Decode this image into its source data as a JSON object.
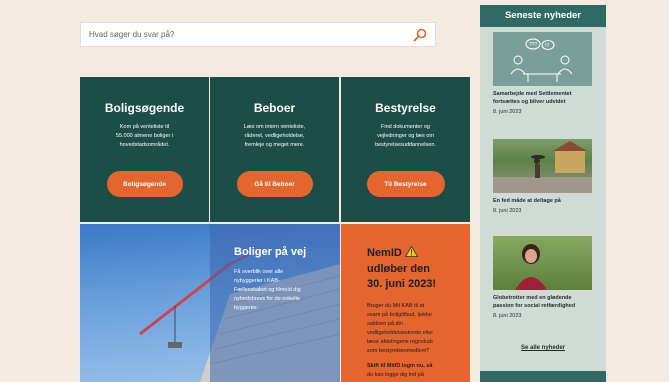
{
  "search": {
    "placeholder": "Hvad søger du svar på?"
  },
  "cards": [
    {
      "title": "Boligsøgende",
      "lines": [
        "Kom på venteliste til",
        "55.000 almene boliger i",
        "hovedstadsområdet."
      ],
      "button": "Boligsøgende"
    },
    {
      "title": "Beboer",
      "lines": [
        "Læs om intern venteliste,",
        "råderet, vedligeholdelse,",
        "fremleje og meget mere."
      ],
      "button": "Gå til Beboer"
    },
    {
      "title": "Bestyrelse",
      "lines": [
        "Find dokumenter og",
        "vejledninger og læs om",
        "bestyrelsesuddannelsen."
      ],
      "button": "Til Bestyrelse"
    }
  ],
  "promo": {
    "title": "Boliger på vej",
    "lines": [
      "Få overblik over alle",
      "nybyggerier i KAB-",
      "Fællesskabet og tilmeld dig",
      "nyhedsbrevs for de enkelte",
      "byggerier."
    ]
  },
  "alert": {
    "title_lines": [
      "NemID",
      "udløber den",
      "30. juni 2023!"
    ],
    "para_lines": [
      "Bruger du Mit KAB til at",
      "svare på boligtilbud, tjekke",
      "saldoen på din",
      "vedligeholdelseskonto eller",
      "læse afdelingens regnskab",
      "som bestyrelsesmedlem?"
    ],
    "para2_lines": [
      "Skift til MitID login nu, så",
      "du kan logge dig ind på"
    ]
  },
  "news": {
    "heading": "Seneste nyheder",
    "items": [
      {
        "title_lines": [
          "Samarbejde med Settlementet",
          "fortsættes og bliver udvidet"
        ],
        "date": "8. juni 2023"
      },
      {
        "title_lines": [
          "En fed måde at deltage på"
        ],
        "date": "8. juni 2023"
      },
      {
        "title_lines": [
          "Globetrotter med en glødende",
          "passion for social retfærdighed"
        ],
        "date": "8. juni 2023"
      }
    ],
    "see_all": "Se alle nyheder"
  },
  "colors": {
    "teal": "#1d4d47",
    "orange": "#e4652e",
    "sidebar": "#cfdbd4",
    "sidebar_head": "#2f6a64",
    "bg": "#f3ebe1"
  }
}
